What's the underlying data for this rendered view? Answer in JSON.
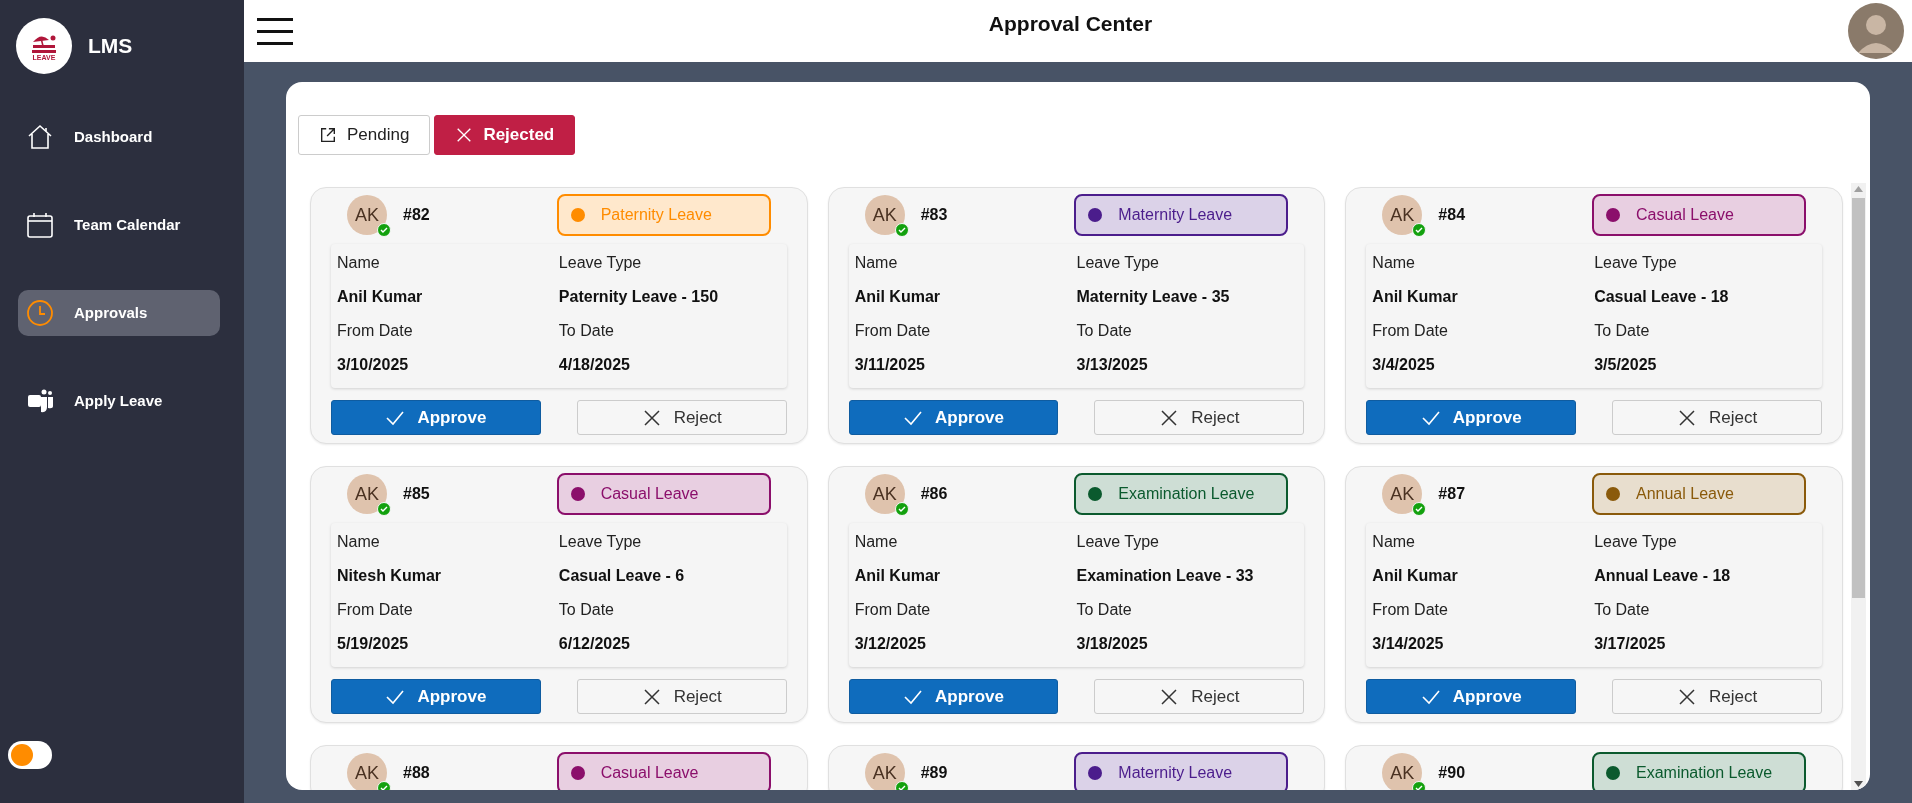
{
  "app": {
    "name": "LMS",
    "logo_text": "LEAVE"
  },
  "sidebar": {
    "items": [
      {
        "label": "Dashboard",
        "kind": "home",
        "selected": false
      },
      {
        "label": "Team Calendar",
        "kind": "calendar",
        "selected": false
      },
      {
        "label": "Approvals",
        "kind": "clock",
        "selected": true
      },
      {
        "label": "Apply Leave",
        "kind": "app",
        "selected": false
      }
    ],
    "theme_toggle": {
      "on": false
    }
  },
  "header": {
    "title": "Approval Center"
  },
  "tabs": [
    {
      "label": "Pending",
      "kind": "external",
      "selected": false
    },
    {
      "label": "Rejected",
      "kind": "x",
      "selected": true
    }
  ],
  "requests": [
    {
      "initials": "AK",
      "id": "#82",
      "leave": "Paternity Leave",
      "color": "#ff8c00",
      "fields": [
        {
          "label": "Name",
          "value": "Anil Kumar"
        },
        {
          "label": "Leave Type",
          "value": "Paternity Leave - 150"
        },
        {
          "label": "From Date",
          "value": "3/10/2025"
        },
        {
          "label": "To Date",
          "value": "4/18/2025"
        }
      ],
      "buttons": [
        "Approve",
        "Reject"
      ]
    },
    {
      "initials": "AK",
      "id": "#83",
      "leave": "Maternity Leave",
      "color": "#4b1d8c",
      "fields": [
        {
          "label": "Name",
          "value": "Anil Kumar"
        },
        {
          "label": "Leave Type",
          "value": "Maternity Leave - 35"
        },
        {
          "label": "From Date",
          "value": "3/11/2025"
        },
        {
          "label": "To Date",
          "value": "3/13/2025"
        }
      ],
      "buttons": [
        "Approve",
        "Reject"
      ]
    },
    {
      "initials": "AK",
      "id": "#84",
      "leave": "Casual Leave",
      "color": "#8b0f6b",
      "fields": [
        {
          "label": "Name",
          "value": "Anil Kumar"
        },
        {
          "label": "Leave Type",
          "value": "Casual Leave - 18"
        },
        {
          "label": "From Date",
          "value": "3/4/2025"
        },
        {
          "label": "To Date",
          "value": "3/5/2025"
        }
      ],
      "buttons": [
        "Approve",
        "Reject"
      ]
    },
    {
      "initials": "AK",
      "id": "#85",
      "leave": "Casual Leave",
      "color": "#8b0f6b",
      "fields": [
        {
          "label": "Name",
          "value": "Nitesh Kumar"
        },
        {
          "label": "Leave Type",
          "value": "Casual Leave - 6"
        },
        {
          "label": "From Date",
          "value": "5/19/2025"
        },
        {
          "label": "To Date",
          "value": "6/12/2025"
        }
      ],
      "buttons": [
        "Approve",
        "Reject"
      ]
    },
    {
      "initials": "AK",
      "id": "#86",
      "leave": "Examination Leave",
      "color": "#0b5a2e",
      "fields": [
        {
          "label": "Name",
          "value": "Anil Kumar"
        },
        {
          "label": "Leave Type",
          "value": "Examination Leave - 33"
        },
        {
          "label": "From Date",
          "value": "3/12/2025"
        },
        {
          "label": "To Date",
          "value": "3/18/2025"
        }
      ],
      "buttons": [
        "Approve",
        "Reject"
      ]
    },
    {
      "initials": "AK",
      "id": "#87",
      "leave": "Annual Leave",
      "color": "#8a5a0b",
      "fields": [
        {
          "label": "Name",
          "value": "Anil Kumar"
        },
        {
          "label": "Leave Type",
          "value": "Annual Leave - 18"
        },
        {
          "label": "From Date",
          "value": "3/14/2025"
        },
        {
          "label": "To Date",
          "value": "3/17/2025"
        }
      ],
      "buttons": [
        "Approve",
        "Reject"
      ]
    },
    {
      "initials": "AK",
      "id": "#88",
      "leave": "Casual Leave",
      "color": "#8b0f6b"
    },
    {
      "initials": "AK",
      "id": "#89",
      "leave": "Maternity Leave",
      "color": "#4b1d8c"
    },
    {
      "initials": "AK",
      "id": "#90",
      "leave": "Examination Leave",
      "color": "#0b5a2e"
    }
  ]
}
